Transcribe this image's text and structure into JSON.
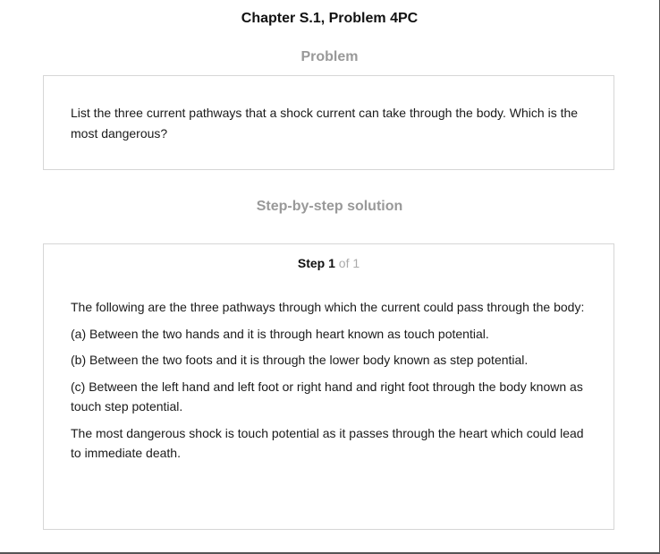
{
  "header": {
    "chapter_title": "Chapter S.1, Problem 4PC"
  },
  "problem": {
    "heading": "Problem",
    "text": "List the three current pathways that a shock current can take through the body. Which is the most dangerous?"
  },
  "solution": {
    "heading": "Step-by-step solution",
    "step": {
      "word": "Step",
      "number": "1",
      "of_text": "of 1"
    },
    "paragraphs": [
      "The following are the three pathways through which the current could pass through the body:",
      "(a) Between the two hands and it is through heart known as touch potential.",
      "(b) Between the two foots and it is through the lower body known as step potential.",
      "(c) Between the left hand and left foot or right hand and right foot through the body known as touch step potential.",
      "The most dangerous shock is touch potential as it passes through the heart which could lead to immediate death."
    ]
  }
}
